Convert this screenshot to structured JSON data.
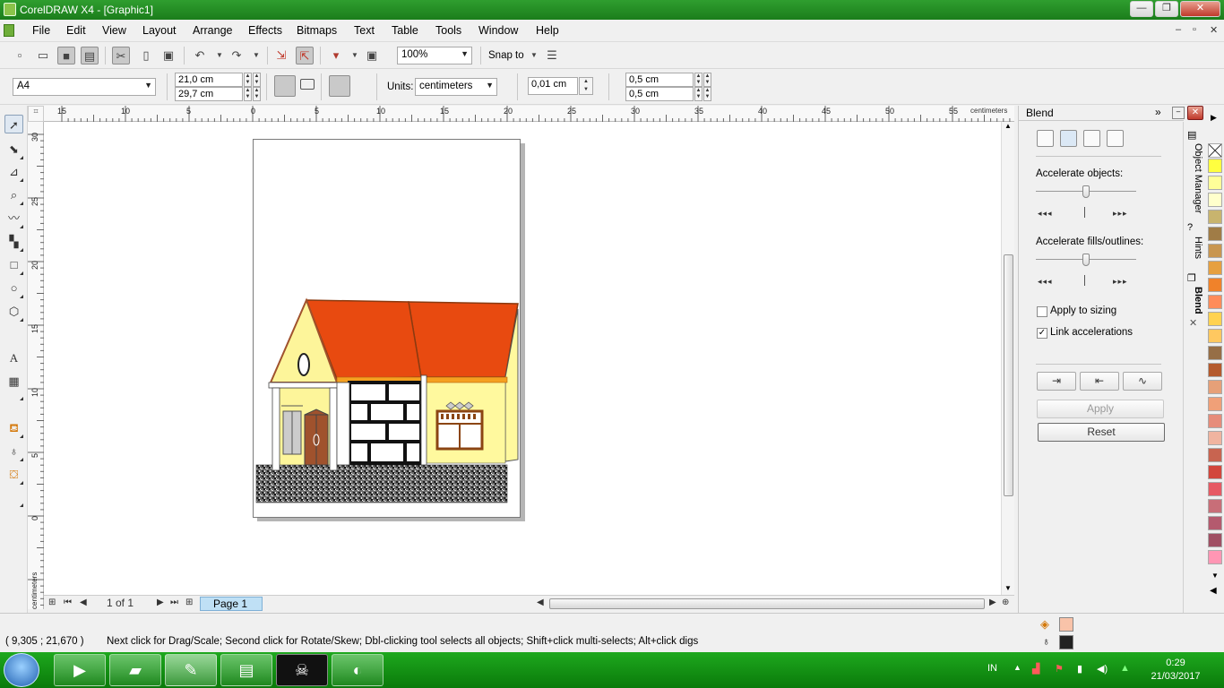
{
  "window": {
    "title": "CorelDRAW X4 - [Graphic1]",
    "minimize_glyph": "—",
    "restore_glyph": "❐",
    "close_glyph": "✕"
  },
  "menu": {
    "items": [
      "File",
      "Edit",
      "View",
      "Layout",
      "Arrange",
      "Effects",
      "Bitmaps",
      "Text",
      "Table",
      "Tools",
      "Window",
      "Help"
    ],
    "mdi_minimize": "–",
    "mdi_restore": "▫",
    "mdi_close": "✕"
  },
  "standard_toolbar": {
    "zoom_value": "100%",
    "snap_to_label": "Snap to",
    "icons": [
      "new-icon",
      "open-icon",
      "save-icon",
      "print-icon",
      "cut-icon",
      "copy-icon",
      "paste-icon",
      "undo-icon",
      "redo-icon",
      "import-icon",
      "export-icon",
      "application-launcher-icon",
      "welcome-screen-icon",
      "options-icon"
    ]
  },
  "property_bar": {
    "paper_size": "A4",
    "width": "21,0 cm",
    "height": "29,7 cm",
    "units_label": "Units:",
    "units_value": "centimeters",
    "nudge": "0,01 cm",
    "dup_x": "0,5 cm",
    "dup_y": "0,5 cm"
  },
  "rulers": {
    "unit": "centimeters",
    "horizontal": [
      {
        "value": "15"
      },
      {
        "value": "10"
      },
      {
        "value": "5"
      },
      {
        "value": "0"
      },
      {
        "value": "5"
      },
      {
        "value": "10"
      },
      {
        "value": "15"
      },
      {
        "value": "20"
      },
      {
        "value": "25"
      },
      {
        "value": "30"
      },
      {
        "value": "35"
      },
      {
        "value": "40"
      },
      {
        "value": "45"
      },
      {
        "value": "50"
      },
      {
        "value": "55"
      }
    ],
    "vertical": [
      {
        "value": "30"
      },
      {
        "value": "25"
      },
      {
        "value": "20"
      },
      {
        "value": "15"
      },
      {
        "value": "10"
      },
      {
        "value": "5"
      },
      {
        "value": "0"
      }
    ]
  },
  "page_nav": {
    "page_count": "1 of 1",
    "page_tab": "Page 1"
  },
  "docker": {
    "title": "Blend",
    "accelerate_objects_label": "Accelerate objects:",
    "accelerate_fills_label": "Accelerate fills/outlines:",
    "accelerate_objects_value": 0.5,
    "accelerate_fills_value": 0.5,
    "apply_to_sizing_label": "Apply to sizing",
    "apply_to_sizing_checked": false,
    "link_accelerations_label": "Link accelerations",
    "link_accelerations_checked": true,
    "apply_button": "Apply",
    "reset_button": "Reset",
    "accel_left_glyph": "◂◂◂",
    "accel_right_glyph": "▸▸▸"
  },
  "docker_tabs": [
    "Object Manager",
    "Hints",
    "Blend"
  ],
  "palette": {
    "colors": [
      "#ffff40",
      "#ffff99",
      "#ffffcc",
      "#c8b46e",
      "#a07c46",
      "#c89650",
      "#e6a040",
      "#f0822a",
      "#ff8c5a",
      "#ffd250",
      "#ffc860",
      "#966e46",
      "#b45a2d",
      "#e6a078",
      "#f0a078",
      "#e68c7a",
      "#f0b4a0",
      "#c86450",
      "#d2463c",
      "#e65a64",
      "#c86e78",
      "#b45a6e",
      "#a05064",
      "#ff96b4"
    ]
  },
  "status": {
    "coords": "( 9,305 ; 21,670 )",
    "hint": "Next click for Drag/Scale; Second click for Rotate/Skew; Dbl-clicking tool selects all objects; Shift+click multi-selects; Alt+click digs",
    "fill_color": "#f9c3a9",
    "outline_color": "#222222"
  },
  "taskbar": {
    "apps": [
      "media-player-icon",
      "file-explorer-icon",
      "coreldraw-icon",
      "winrar-icon",
      "skull-app-icon",
      "paint-icon"
    ],
    "language": "IN",
    "time": "0:29",
    "date": "21/03/2017"
  },
  "drawing": {
    "roof_color": "#e84a10",
    "wall_color": "#fdf59a",
    "wall_light_color": "#fff99e",
    "door_color": "#a0522d",
    "ground_color": "#555555"
  }
}
